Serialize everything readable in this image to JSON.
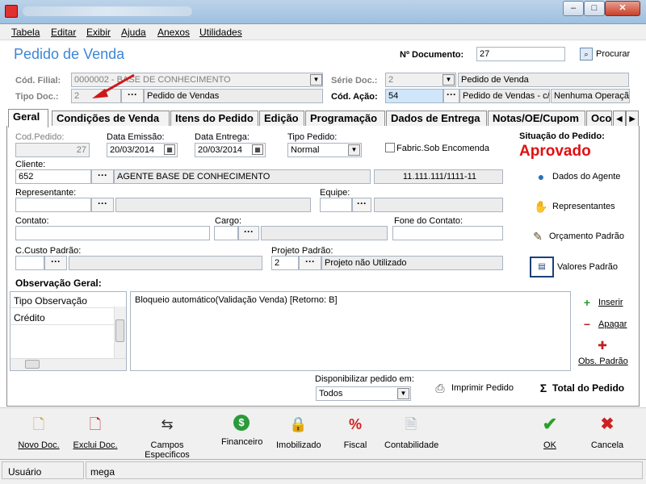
{
  "window": {
    "title": "",
    "minimize": "–",
    "maximize": "□",
    "close": "✕"
  },
  "menu": [
    "Tabela",
    "Editar",
    "Exibir",
    "Ajuda",
    "Anexos",
    "Utilidades"
  ],
  "header": {
    "title": "Pedido de Venda",
    "doc_label": "Nº Documento:",
    "doc_value": "27",
    "search_label": "Procurar"
  },
  "filial": {
    "label": "Cód. Filial:",
    "value": "0000002 - BASE DE CONHECIMENTO"
  },
  "serie": {
    "label": "Série Doc.:",
    "value": "2",
    "desc": "Pedido de Venda"
  },
  "tipo_doc": {
    "label": "Tipo Doc.:",
    "value": "2",
    "desc": "Pedido de Vendas"
  },
  "acao": {
    "label": "Cód. Ação:",
    "value": "54",
    "desc": "Pedido de Vendas - c/",
    "desc2": "Nenhuma Operação"
  },
  "tabs": [
    "Geral",
    "Condições de Venda",
    "Itens do Pedido",
    "Edição",
    "Programação",
    "Dados de Entrega",
    "Notas/OE/Cupom",
    "Oco"
  ],
  "form": {
    "cod_pedido_label": "Cod.Pedido:",
    "cod_pedido": "27",
    "emissao_label": "Data Emissão:",
    "emissao": "20/03/2014",
    "entrega_label": "Data Entrega:",
    "entrega": "20/03/2014",
    "tipo_pedido_label": "Tipo Pedido:",
    "tipo_pedido": "Normal",
    "fabric_label": "Fabric.Sob Encomenda",
    "cliente_label": "Cliente:",
    "cliente": "652",
    "cliente_nome": "AGENTE BASE DE CONHECIMENTO",
    "cliente_doc": "11.111.111/1111-11",
    "representante_label": "Representante:",
    "equipe_label": "Equipe:",
    "contato_label": "Contato:",
    "cargo_label": "Cargo:",
    "fone_label": "Fone do Contato:",
    "ccusto_label": "C.Custo Padrão:",
    "projeto_label": "Projeto Padrão:",
    "projeto": "2",
    "projeto_desc": "Projeto não Utilizado",
    "obs_label": "Observação Geral:",
    "obs_list": [
      "Tipo Observação",
      "Crédito"
    ],
    "obs_text": "Bloqueio automático(Validação Venda) [Retorno: B]",
    "disponibilizar_label": "Disponibilizar pedido em:",
    "disponibilizar": "Todos"
  },
  "side": {
    "situacao_label": "Situação do Pedido:",
    "situacao": "Aprovado",
    "dados_agente": "Dados do Agente",
    "representantes": "Representantes",
    "orcamento": "Orçamento Padrão",
    "valores": "Valores Padrão",
    "inserir": "Inserir",
    "apagar": "Apagar",
    "obs_padrao": "Obs. Padrão",
    "imprimir": "Imprimir Pedido",
    "total": "Total do Pedido"
  },
  "toolbar": [
    "Novo Doc.",
    "Exclui Doc.",
    "Campos Especificos",
    "Financeiro",
    "Imobilizado",
    "Fiscal",
    "Contabilidade",
    "OK",
    "Cancela"
  ],
  "status": {
    "user_label": "Usuário",
    "user": "mega"
  },
  "colors": {
    "accent": "#3c86d6",
    "approved": "#e01010"
  }
}
